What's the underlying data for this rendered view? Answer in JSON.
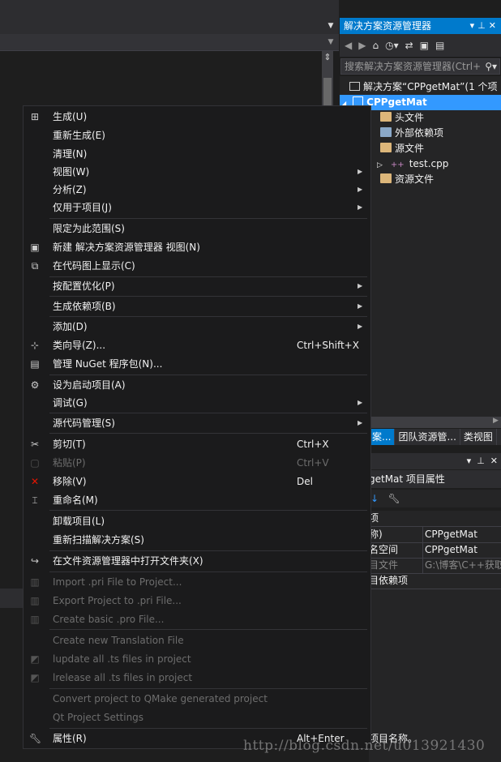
{
  "explorer": {
    "title": "解决方案资源管理器",
    "search_placeholder": "搜索解决方案资源管理器(Ctrl+",
    "tree": [
      {
        "label": "解决方案“CPPgetMat”(1 个项",
        "icon": "solution-icon"
      },
      {
        "label": "CPPgetMat",
        "icon": "project-icon"
      },
      {
        "label": "头文件",
        "icon": "folder-icon"
      },
      {
        "label": "外部依赖项",
        "icon": "external-deps-icon"
      },
      {
        "label": "源文件",
        "icon": "folder-icon"
      },
      {
        "label": "test.cpp",
        "icon": "cpp-file-icon"
      },
      {
        "label": "资源文件",
        "icon": "folder-icon"
      }
    ]
  },
  "tabs": [
    "案...",
    "团队资源管...",
    "类视图"
  ],
  "properties": {
    "title": "getMat 项目属性",
    "rows": [
      {
        "key": "项",
        "value": ""
      },
      {
        "key": "称)",
        "value": "CPPgetMat"
      },
      {
        "key": "名空间",
        "value": "CPPgetMat"
      },
      {
        "key": "目文件",
        "value": "G:\\博客\\C++获取"
      },
      {
        "key": "目依赖项",
        "value": ""
      }
    ],
    "description": "项目名称。"
  },
  "menu": {
    "items": [
      {
        "label": "生成(U)",
        "icon": "build-icon"
      },
      {
        "label": "重新生成(E)"
      },
      {
        "label": "清理(N)"
      },
      {
        "label": "视图(W)",
        "submenu": true
      },
      {
        "label": "分析(Z)",
        "submenu": true
      },
      {
        "label": "仅用于项目(J)",
        "submenu": true
      },
      {
        "label": "限定为此范围(S)"
      },
      {
        "label": "新建 解决方案资源管理器 视图(N)",
        "icon": "new-view-icon"
      },
      {
        "label": "在代码图上显示(C)",
        "icon": "code-map-icon"
      },
      {
        "label": "按配置优化(P)",
        "submenu": true
      },
      {
        "label": "生成依赖项(B)",
        "submenu": true
      },
      {
        "label": "添加(D)",
        "submenu": true
      },
      {
        "label": "类向导(Z)...",
        "icon": "class-wizard-icon",
        "shortcut": "Ctrl+Shift+X"
      },
      {
        "label": "管理 NuGet 程序包(N)...",
        "icon": "nuget-icon"
      },
      {
        "label": "设为启动项目(A)",
        "icon": "gear-icon"
      },
      {
        "label": "调试(G)",
        "submenu": true
      },
      {
        "label": "源代码管理(S)",
        "submenu": true
      },
      {
        "label": "剪切(T)",
        "icon": "scissors-icon",
        "shortcut": "Ctrl+X"
      },
      {
        "label": "粘贴(P)",
        "icon": "paste-icon",
        "shortcut": "Ctrl+V",
        "disabled": true
      },
      {
        "label": "移除(V)",
        "icon": "remove-icon",
        "shortcut": "Del"
      },
      {
        "label": "重命名(M)",
        "icon": "rename-icon"
      },
      {
        "label": "卸载项目(L)"
      },
      {
        "label": "重新扫描解决方案(S)"
      },
      {
        "label": "在文件资源管理器中打开文件夹(X)",
        "icon": "open-folder-icon"
      },
      {
        "label": "Import .pri File to Project...",
        "icon": "import-pri-icon",
        "disabled": true
      },
      {
        "label": "Export Project to .pri File...",
        "icon": "export-pri-icon",
        "disabled": true
      },
      {
        "label": "Create basic .pro File...",
        "icon": "create-pro-icon",
        "disabled": true
      },
      {
        "label": "Create new Translation File",
        "disabled": true
      },
      {
        "label": "lupdate all .ts files in project",
        "icon": "lupdate-icon",
        "disabled": true
      },
      {
        "label": "lrelease all .ts files in project",
        "icon": "lrelease-icon",
        "disabled": true
      },
      {
        "label": "Convert project to QMake generated project",
        "disabled": true
      },
      {
        "label": "Qt Project Settings",
        "disabled": true
      },
      {
        "label": "属性(R)",
        "icon": "wrench-icon",
        "shortcut": "Alt+Enter"
      }
    ]
  },
  "watermark": "http://blog.csdn.net/u013921430"
}
